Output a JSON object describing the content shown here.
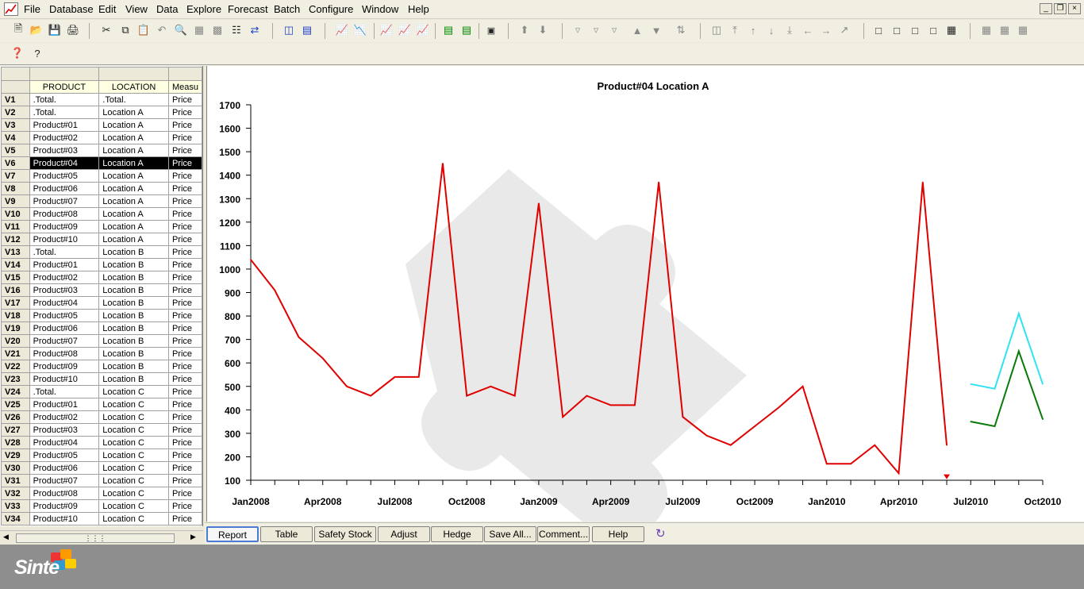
{
  "menu": [
    "File",
    "Database",
    "Edit",
    "View",
    "Data",
    "Explore",
    "Forecast",
    "Batch",
    "Configure",
    "Window",
    "Help"
  ],
  "window_controls": [
    "_",
    "❐",
    "×"
  ],
  "grid": {
    "headers": [
      "PRODUCT",
      "LOCATION",
      "Measu"
    ],
    "rows": [
      [
        "V1",
        ".Total.",
        ".Total.",
        "Price"
      ],
      [
        "V2",
        ".Total.",
        "Location A",
        "Price"
      ],
      [
        "V3",
        "Product#01",
        "Location A",
        "Price"
      ],
      [
        "V4",
        "Product#02",
        "Location A",
        "Price"
      ],
      [
        "V5",
        "Product#03",
        "Location A",
        "Price"
      ],
      [
        "V6",
        "Product#04",
        "Location A",
        "Price"
      ],
      [
        "V7",
        "Product#05",
        "Location A",
        "Price"
      ],
      [
        "V8",
        "Product#06",
        "Location A",
        "Price"
      ],
      [
        "V9",
        "Product#07",
        "Location A",
        "Price"
      ],
      [
        "V10",
        "Product#08",
        "Location A",
        "Price"
      ],
      [
        "V11",
        "Product#09",
        "Location A",
        "Price"
      ],
      [
        "V12",
        "Product#10",
        "Location A",
        "Price"
      ],
      [
        "V13",
        ".Total.",
        "Location B",
        "Price"
      ],
      [
        "V14",
        "Product#01",
        "Location B",
        "Price"
      ],
      [
        "V15",
        "Product#02",
        "Location B",
        "Price"
      ],
      [
        "V16",
        "Product#03",
        "Location B",
        "Price"
      ],
      [
        "V17",
        "Product#04",
        "Location B",
        "Price"
      ],
      [
        "V18",
        "Product#05",
        "Location B",
        "Price"
      ],
      [
        "V19",
        "Product#06",
        "Location B",
        "Price"
      ],
      [
        "V20",
        "Product#07",
        "Location B",
        "Price"
      ],
      [
        "V21",
        "Product#08",
        "Location B",
        "Price"
      ],
      [
        "V22",
        "Product#09",
        "Location B",
        "Price"
      ],
      [
        "V23",
        "Product#10",
        "Location B",
        "Price"
      ],
      [
        "V24",
        ".Total.",
        "Location C",
        "Price"
      ],
      [
        "V25",
        "Product#01",
        "Location C",
        "Price"
      ],
      [
        "V26",
        "Product#02",
        "Location C",
        "Price"
      ],
      [
        "V27",
        "Product#03",
        "Location C",
        "Price"
      ],
      [
        "V28",
        "Product#04",
        "Location C",
        "Price"
      ],
      [
        "V29",
        "Product#05",
        "Location C",
        "Price"
      ],
      [
        "V30",
        "Product#06",
        "Location C",
        "Price"
      ],
      [
        "V31",
        "Product#07",
        "Location C",
        "Price"
      ],
      [
        "V32",
        "Product#08",
        "Location C",
        "Price"
      ],
      [
        "V33",
        "Product#09",
        "Location C",
        "Price"
      ],
      [
        "V34",
        "Product#10",
        "Location C",
        "Price"
      ]
    ],
    "selected_row": "V6"
  },
  "tabs": [
    "Report",
    "Table",
    "Safety Stock",
    "Adjust",
    "Hedge",
    "Save All...",
    "Comment...",
    "Help"
  ],
  "active_tab": "Report",
  "footer": {
    "logo_text": "Sinte"
  },
  "colors": {
    "history": "#e00000",
    "forecast_upper": "#2fe3f0",
    "forecast_main": "#087a08"
  },
  "chart_data": {
    "type": "line",
    "title": "Product#04 Location A",
    "xlabel": "",
    "ylabel": "",
    "ylim": [
      100,
      1700
    ],
    "yticks": [
      100,
      200,
      300,
      400,
      500,
      600,
      700,
      800,
      900,
      1000,
      1100,
      1200,
      1300,
      1400,
      1500,
      1600,
      1700
    ],
    "x_tick_labels": [
      "Jan2008",
      "Apr2008",
      "Jul2008",
      "Oct2008",
      "Jan2009",
      "Apr2009",
      "Jul2009",
      "Oct2009",
      "Jan2010",
      "Apr2010",
      "Jul2010",
      "Oct2010"
    ],
    "x_range": [
      "Jan2008",
      "Oct2010"
    ],
    "grid": false,
    "series": [
      {
        "role": "history",
        "color": "#e00000",
        "x": [
          "Jan2008",
          "Feb2008",
          "Mar2008",
          "Apr2008",
          "May2008",
          "Jun2008",
          "Jul2008",
          "Aug2008",
          "Sep2008",
          "Oct2008",
          "Nov2008",
          "Dec2008",
          "Jan2009",
          "Feb2009",
          "Mar2009",
          "Apr2009",
          "May2009",
          "Jun2009",
          "Jul2009",
          "Aug2009",
          "Sep2009",
          "Oct2009",
          "Nov2009",
          "Dec2009",
          "Jan2010",
          "Feb2010",
          "Mar2010",
          "Apr2010",
          "May2010",
          "Jun2010"
        ],
        "values": [
          1040,
          910,
          710,
          620,
          500,
          460,
          540,
          540,
          1450,
          460,
          500,
          460,
          1280,
          370,
          460,
          420,
          420,
          1370,
          370,
          290,
          250,
          330,
          410,
          500,
          170,
          170,
          250,
          130,
          1370,
          250
        ]
      },
      {
        "role": "forecast-upper",
        "color": "#2fe3f0",
        "x": [
          "Jul2010",
          "Aug2010",
          "Sep2010",
          "Oct2010"
        ],
        "values": [
          510,
          490,
          810,
          510
        ]
      },
      {
        "role": "forecast",
        "color": "#087a08",
        "x": [
          "Jul2010",
          "Aug2010",
          "Sep2010",
          "Oct2010"
        ],
        "values": [
          350,
          330,
          650,
          360
        ]
      }
    ],
    "marker": {
      "x": "Jun2010",
      "value": 115,
      "color": "#e00000"
    }
  }
}
